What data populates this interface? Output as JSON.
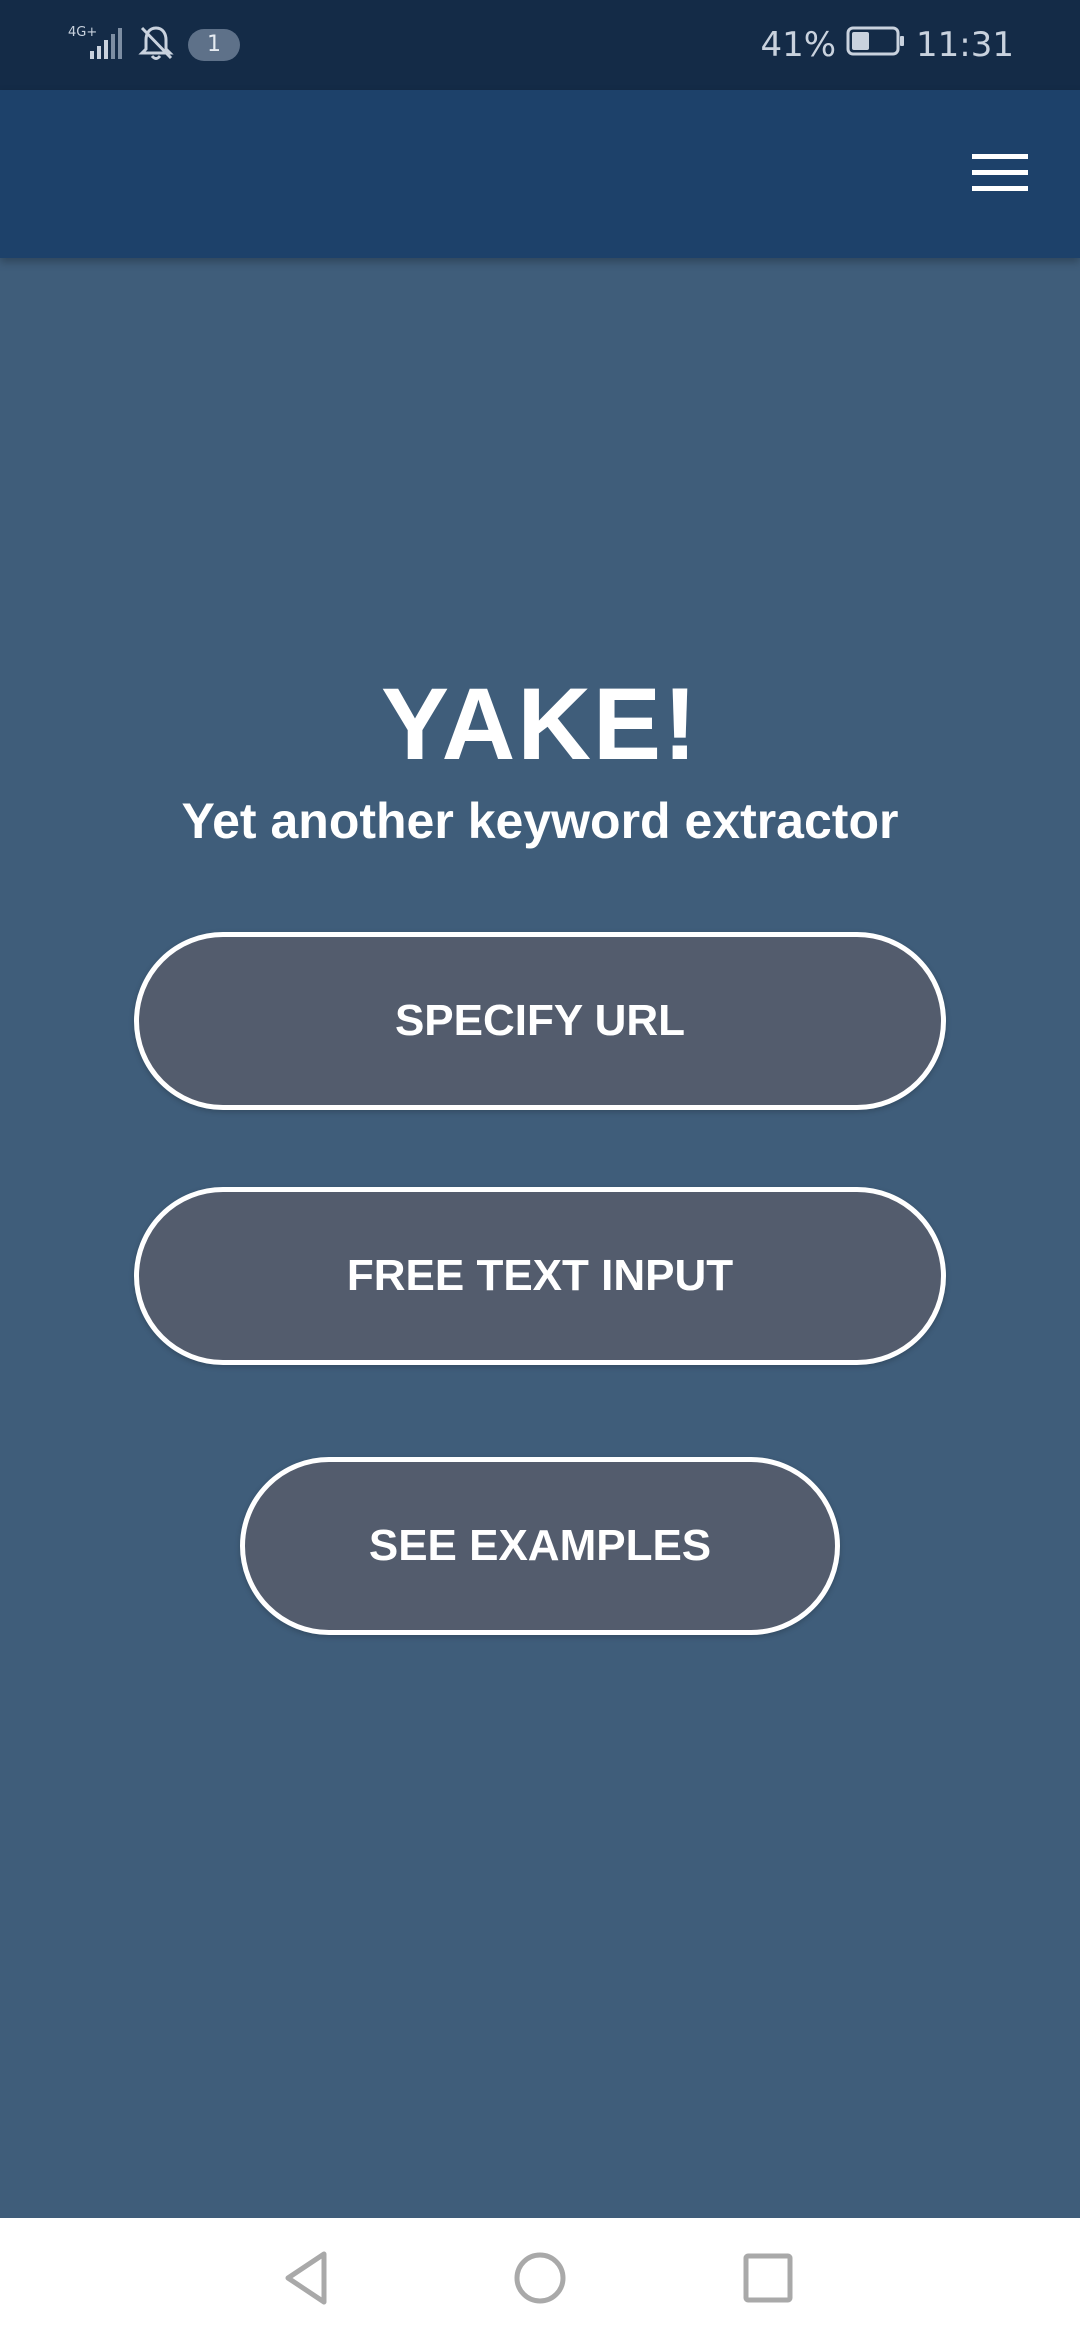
{
  "status_bar": {
    "network": "4G+",
    "notification_count": "1",
    "battery_percent": "41%",
    "battery_level": 0.41,
    "time": "11:31",
    "icons": [
      "signal-icon",
      "bell-off-icon",
      "battery-icon"
    ]
  },
  "app_bar": {
    "menu_icon": "hamburger-menu-icon"
  },
  "hero": {
    "title": "YAKE!",
    "subtitle": "Yet another keyword extractor"
  },
  "actions": {
    "specify_url": "SPECIFY URL",
    "free_text_input": "FREE TEXT INPUT",
    "see_examples": "SEE EXAMPLES"
  },
  "nav_bar": {
    "icons": [
      "back-icon",
      "home-icon",
      "recents-icon"
    ]
  },
  "colors": {
    "status_bar_bg": "#142b47",
    "app_bar_bg": "#1d416a",
    "page_bg": "#3f5d7a",
    "button_bg": "#535c6d",
    "button_border": "#ffffff",
    "nav_bar_bg": "#ffffff"
  }
}
